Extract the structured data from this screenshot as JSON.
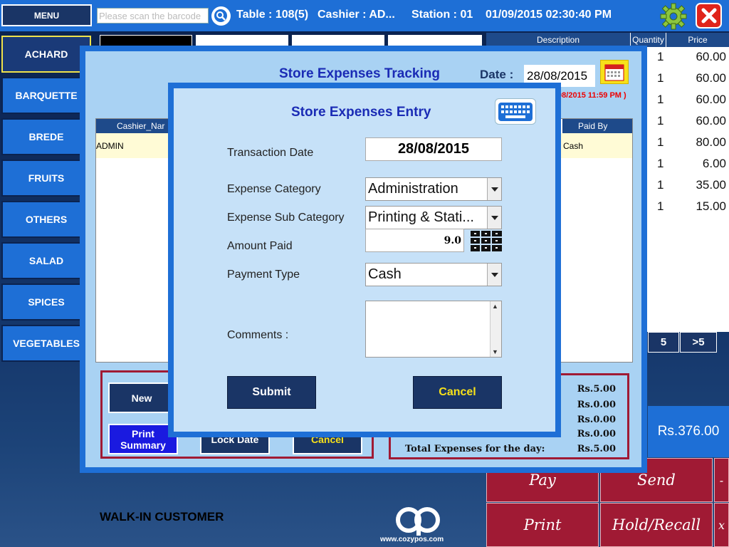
{
  "header": {
    "menu_label": "MENU",
    "scan_placeholder": "Please scan the barcode",
    "table": "Table : 108(5)",
    "cashier": "Cashier : AD...",
    "station": "Station : 01",
    "datetime": "01/09/2015 02:30:40 PM",
    "settings_icon": "gear-icon",
    "close_icon": "close-icon",
    "accent_color": "#1e6fd6",
    "close_color": "#e0241b"
  },
  "categories": [
    "ACHARD",
    "BARQUETTE",
    "BREDE",
    "FRUITS",
    "OTHERS",
    "SALAD",
    "SPICES",
    "VEGETABLES"
  ],
  "order": {
    "columns": [
      "Description",
      "Quantity",
      "Price"
    ],
    "rows": [
      {
        "qty": "1",
        "price": "60.00"
      },
      {
        "qty": "1",
        "price": "60.00"
      },
      {
        "qty": "1",
        "price": "60.00"
      },
      {
        "qty": "1",
        "price": "60.00"
      },
      {
        "qty": "1",
        "price": "80.00"
      },
      {
        "qty": "1",
        "price": "6.00"
      },
      {
        "qty": "1",
        "price": "35.00"
      },
      {
        "qty": "1",
        "price": "15.00"
      }
    ],
    "pages": [
      "5",
      ">5"
    ],
    "total": "Rs.376.00"
  },
  "actions": {
    "pay": "Pay",
    "send": "Send",
    "print": "Print",
    "hold": "Hold/Recall",
    "minus": "-",
    "x": "x",
    "action_color": "#a01a34"
  },
  "footer": {
    "customer": "WALK-IN CUSTOMER",
    "logo_url_text": "www.cozypos.com"
  },
  "tracking": {
    "title": "Store Expenses Tracking",
    "date_label": "Date :",
    "date_value": "28/08/2015",
    "range_note": "/08/2015 11:59 PM )",
    "grid_columns": [
      "Cashier_Nar",
      "Paid By"
    ],
    "grid_row": {
      "cashier": "ADMIN",
      "paid_by": "Cash"
    },
    "buttons": {
      "new": "New",
      "print_summary": "Print Summary",
      "lock_date": "Lock Date",
      "cancel": "Cancel"
    },
    "summary": {
      "amounts": [
        "Rs.5.00",
        "Rs.0.00",
        "Rs.0.00",
        "Rs.0.00"
      ],
      "total_label": "Total Expenses for the day:",
      "total_value": "Rs.5.00"
    }
  },
  "entry": {
    "title": "Store Expenses Entry",
    "keyboard_icon": "keyboard-icon",
    "fields": {
      "transaction_date_label": "Transaction Date",
      "transaction_date_value": "28/08/2015",
      "expense_category_label": "Expense Category",
      "expense_category_value": "Administration",
      "expense_sub_category_label": "Expense Sub Category",
      "expense_sub_category_value": "Printing & Stati...",
      "amount_paid_label": "Amount Paid",
      "amount_paid_value": "9.0",
      "payment_type_label": "Payment Type",
      "payment_type_value": "Cash",
      "comments_label": "Comments :",
      "comments_value": ""
    },
    "submit": "Submit",
    "cancel": "Cancel",
    "cancel_text_color": "#f7e11a"
  }
}
